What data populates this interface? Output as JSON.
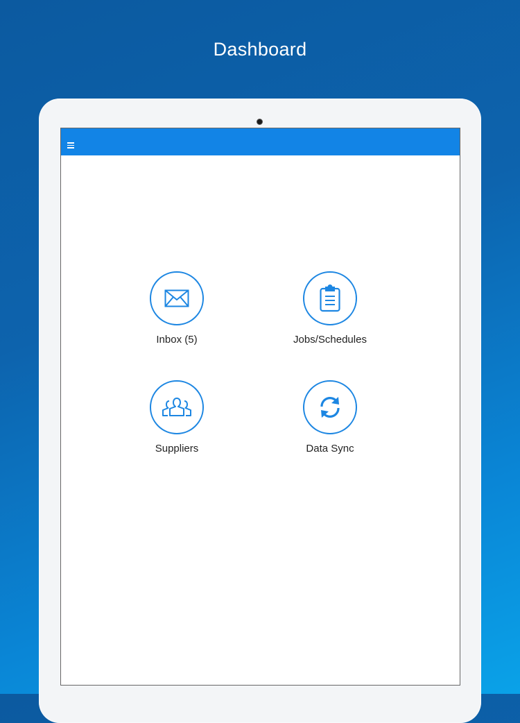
{
  "header": {
    "title": "Dashboard"
  },
  "app_bar": {
    "menu_icon": "hamburger-menu-icon",
    "color": "#1284e6"
  },
  "tiles": [
    {
      "label": "Inbox (5)",
      "icon": "envelope-icon"
    },
    {
      "label": "Jobs/Schedules",
      "icon": "clipboard-icon"
    },
    {
      "label": "Suppliers",
      "icon": "people-group-icon"
    },
    {
      "label": "Data Sync",
      "icon": "sync-icon"
    }
  ],
  "colors": {
    "accent": "#1c86e2",
    "background_top": "#0c5aa0",
    "background_bottom": "#0aa2e8"
  }
}
